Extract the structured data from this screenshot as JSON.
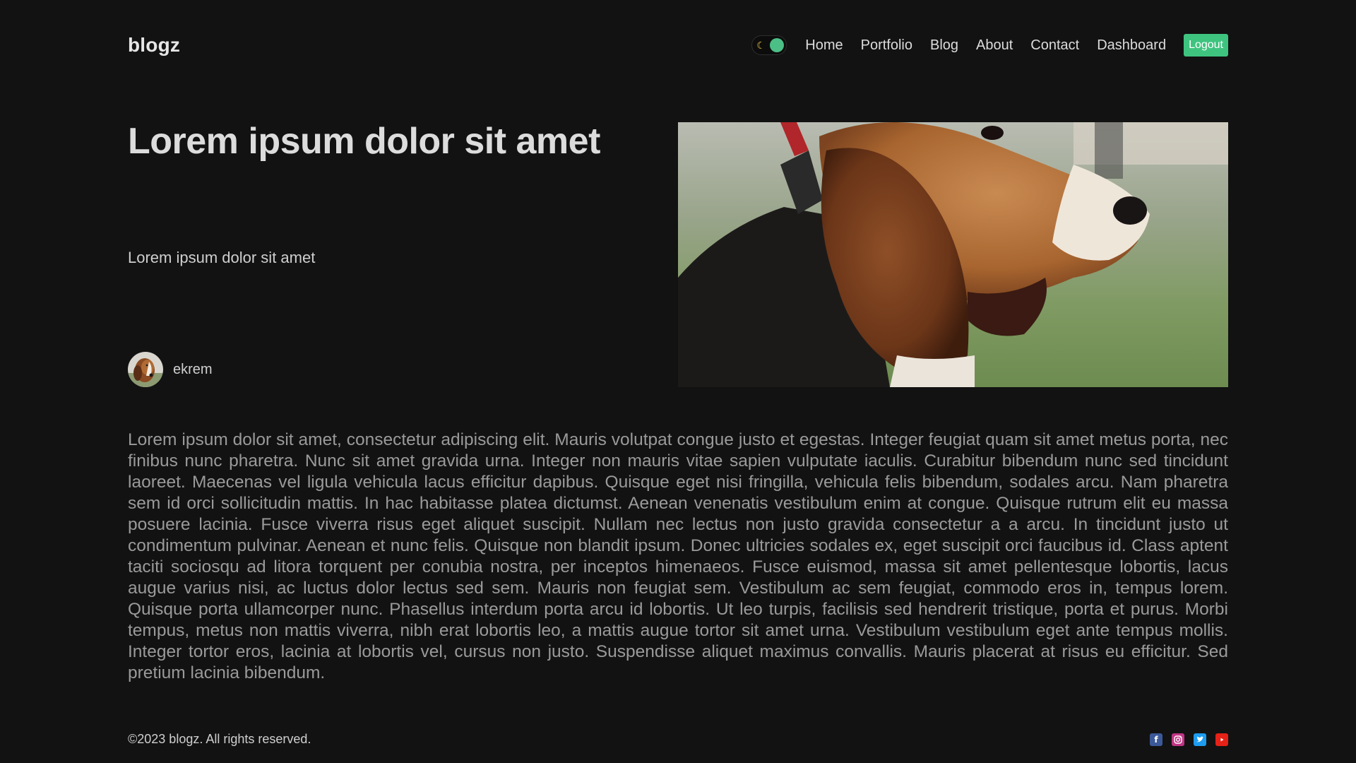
{
  "header": {
    "logo": "blogz",
    "nav": [
      "Home",
      "Portfolio",
      "Blog",
      "About",
      "Contact",
      "Dashboard"
    ],
    "logout_label": "Logout",
    "theme_toggle": {
      "icon": "moon-icon",
      "state": "dark",
      "knob_color": "#4cbf86"
    }
  },
  "post": {
    "title": "Lorem ipsum dolor sit amet",
    "subtitle": "Lorem ipsum dolor sit amet",
    "author": "ekrem",
    "image": "beagle-dog-photo",
    "body": "Lorem ipsum dolor sit amet, consectetur adipiscing elit. Mauris volutpat congue justo et egestas. Integer feugiat quam sit amet metus porta, nec finibus nunc pharetra. Nunc sit amet gravida urna. Integer non mauris vitae sapien vulputate iaculis. Curabitur bibendum nunc sed tincidunt laoreet. Maecenas vel ligula vehicula lacus efficitur dapibus. Quisque eget nisi fringilla, vehicula felis bibendum, sodales arcu. Nam pharetra sem id orci sollicitudin mattis. In hac habitasse platea dictumst. Aenean venenatis vestibulum enim at congue. Quisque rutrum elit eu massa posuere lacinia. Fusce viverra risus eget aliquet suscipit. Nullam nec lectus non justo gravida consectetur a a arcu. In tincidunt justo ut condimentum pulvinar. Aenean et nunc felis. Quisque non blandit ipsum. Donec ultricies sodales ex, eget suscipit orci faucibus id. Class aptent taciti sociosqu ad litora torquent per conubia nostra, per inceptos himenaeos. Fusce euismod, massa sit amet pellentesque lobortis, lacus augue varius nisi, ac luctus dolor lectus sed sem. Mauris non feugiat sem. Vestibulum ac sem feugiat, commodo eros in, tempus lorem. Quisque porta ullamcorper nunc. Phasellus interdum porta arcu id lobortis. Ut leo turpis, facilisis sed hendrerit tristique, porta et purus. Morbi tempus, metus non mattis viverra, nibh erat lobortis leo, a mattis augue tortor sit amet urna. Vestibulum vestibulum eget ante tempus mollis. Integer tortor eros, lacinia at lobortis vel, cursus non justo. Suspendisse aliquet maximus convallis. Mauris placerat at risus eu efficitur. Sed pretium lacinia bibendum."
  },
  "footer": {
    "copyright": "©2023 blogz. All rights reserved.",
    "socials": [
      {
        "icon": "facebook-icon",
        "color": "#3b5998"
      },
      {
        "icon": "instagram-icon",
        "color": "#c13584"
      },
      {
        "icon": "twitter-icon",
        "color": "#1d9bf0"
      },
      {
        "icon": "youtube-icon",
        "color": "#e62117"
      }
    ]
  },
  "colors": {
    "background": "#121212",
    "accent": "#3ec47f",
    "text": "#dcdcdc",
    "body_text": "#9a9a9a"
  }
}
